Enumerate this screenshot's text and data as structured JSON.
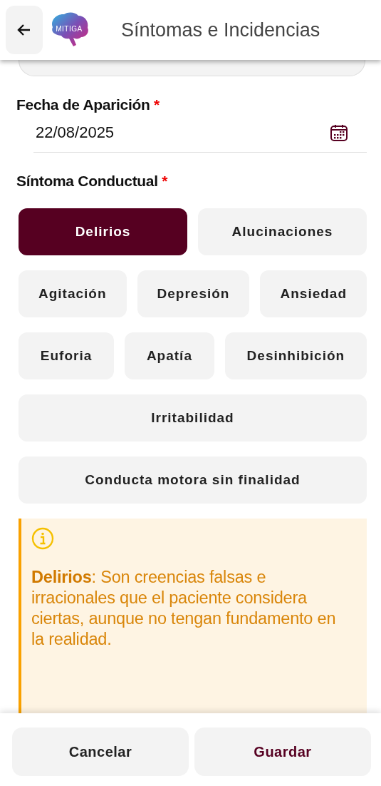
{
  "header": {
    "logo_text": "MITIGA",
    "title": "Síntomas e Incidencias"
  },
  "date_field": {
    "label": "Fecha de Aparición",
    "required_mark": "*",
    "value": "22/08/2025"
  },
  "symptom_field": {
    "label": "Síntoma Conductual",
    "required_mark": "*"
  },
  "symptom_rows": [
    {
      "options": [
        {
          "label": "Delirios",
          "selected": true
        },
        {
          "label": "Alucinaciones",
          "selected": false
        }
      ]
    },
    {
      "options": [
        {
          "label": "Agitación",
          "selected": false
        },
        {
          "label": "Depresión",
          "selected": false
        },
        {
          "label": "Ansiedad",
          "selected": false
        }
      ]
    },
    {
      "options": [
        {
          "label": "Euforia",
          "selected": false
        },
        {
          "label": "Apatía",
          "selected": false
        },
        {
          "label": "Desinhibición",
          "selected": false
        }
      ]
    },
    {
      "options": [
        {
          "label": "Irritabilidad",
          "selected": false
        }
      ]
    },
    {
      "options": [
        {
          "label": "Conducta motora sin finalidad",
          "selected": false
        }
      ]
    }
  ],
  "info": {
    "text": "**Delirios**: Son creencias falsas e irracionales que el paciente considera ciertas, aunque no tengan fundamento en la realidad."
  },
  "buttons": [
    {
      "label": "Cancelar",
      "kind": "secondary"
    },
    {
      "label": "Guardar",
      "kind": "primary"
    }
  ]
}
